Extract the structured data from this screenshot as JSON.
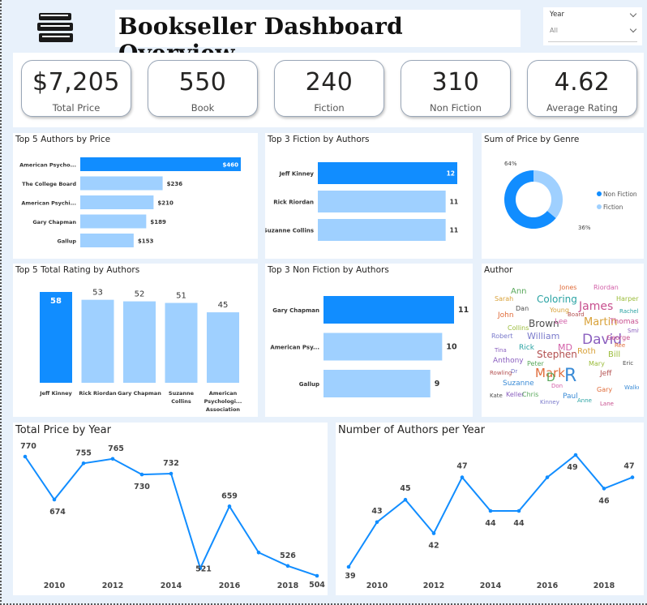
{
  "header": {
    "title": "Bookseller Dashboard Overview",
    "icon": "books-stack-icon",
    "slicer": {
      "label": "Year",
      "selected": "All"
    }
  },
  "kpis": [
    {
      "value": "$7,205",
      "label": "Total Price"
    },
    {
      "value": "550",
      "label": "Book"
    },
    {
      "value": "240",
      "label": "Fiction"
    },
    {
      "value": "310",
      "label": "Non Fiction"
    },
    {
      "value": "4.62",
      "label": "Average Rating"
    }
  ],
  "colors": {
    "accent": "#118dff",
    "light": "#9fd0ff",
    "line": "#118dff"
  },
  "chart_data": [
    {
      "id": "top5_price",
      "type": "bar",
      "orientation": "horizontal",
      "title": "Top 5 Authors by Price",
      "categories": [
        "American Psycho...",
        "The College Board",
        "American Psychi...",
        "Gary Chapman",
        "Gallup"
      ],
      "values": [
        460,
        236,
        210,
        189,
        153
      ],
      "labels": [
        "$460",
        "$236",
        "$210",
        "$189",
        "$153"
      ],
      "xlim": [
        0,
        460
      ]
    },
    {
      "id": "top3_fiction",
      "type": "bar",
      "orientation": "horizontal",
      "title": "Top 3 Fiction by Authors",
      "categories": [
        "Jeff Kinney",
        "Rick Riordan",
        "Suzanne Collins"
      ],
      "values": [
        12,
        11,
        11
      ],
      "labels": [
        "12",
        "11",
        "11"
      ],
      "xlim": [
        0,
        12
      ]
    },
    {
      "id": "price_by_genre",
      "type": "pie",
      "donut": true,
      "title": "Sum of Price by Genre",
      "categories": [
        "Non Fiction",
        "Fiction"
      ],
      "values": [
        64,
        36
      ],
      "labels": [
        "64%",
        "36%"
      ],
      "legend": "right"
    },
    {
      "id": "top5_rating",
      "type": "bar",
      "orientation": "vertical",
      "title": "Top 5 Total Rating by Authors",
      "categories": [
        "Jeff Kinney",
        "Rick Riordan",
        "Gary Chapman",
        "Suzanne Collins",
        "American Psychologi... Association"
      ],
      "values": [
        58,
        53,
        52,
        51,
        45
      ],
      "labels": [
        "58",
        "53",
        "52",
        "51",
        "45"
      ],
      "ylim": [
        0,
        58
      ]
    },
    {
      "id": "top3_nonfiction",
      "type": "bar",
      "orientation": "horizontal",
      "title": "Top 3 Non Fiction by Authors",
      "categories": [
        "Gary Chapman",
        "American Psy...",
        "Gallup"
      ],
      "values": [
        11,
        10,
        9
      ],
      "labels": [
        "11",
        "10",
        "9"
      ],
      "xlim": [
        0,
        11
      ]
    },
    {
      "id": "price_by_year",
      "type": "line",
      "title": "Total Price by Year",
      "x": [
        2009,
        2010,
        2011,
        2012,
        2013,
        2014,
        2015,
        2016,
        2017,
        2018,
        2019
      ],
      "values": [
        770,
        674,
        755,
        765,
        730,
        732,
        521,
        659,
        556,
        526,
        504
      ],
      "labels": [
        "770",
        "674",
        "755",
        "765",
        "730",
        "732",
        "521",
        "659",
        "",
        "526",
        "504"
      ],
      "xticks": [
        "2010",
        "2012",
        "2014",
        "2016",
        "2018"
      ]
    },
    {
      "id": "authors_per_year",
      "type": "line",
      "title": "Number of Authors per Year",
      "x": [
        2009,
        2010,
        2011,
        2012,
        2013,
        2014,
        2015,
        2016,
        2017,
        2018,
        2019
      ],
      "values": [
        39,
        43,
        45,
        42,
        47,
        44,
        44,
        47,
        49,
        46,
        47
      ],
      "labels": [
        "39",
        "43",
        "45",
        "42",
        "47",
        "44",
        "44",
        "",
        "49",
        "46",
        "47"
      ],
      "xticks": [
        "2010",
        "2012",
        "2014",
        "2016",
        "2018"
      ]
    }
  ],
  "author_cloud": {
    "title": "Author",
    "words": [
      "Mark",
      "David",
      "R",
      "D",
      "James",
      "Martin",
      "Brown",
      "Coloring",
      "Stephen",
      "William",
      "Bill",
      "MD",
      "John",
      "Anthony",
      "Suzanne",
      "Ann",
      "Thomas",
      "Roth",
      "Dan",
      "Rick",
      "Jeff",
      "Robert",
      "Harper",
      "Lee",
      "Gary",
      "Keller",
      "Paul",
      "Chris",
      "George",
      "Sarah",
      "Eric",
      "Anne",
      "Rowling",
      "Kinney",
      "Collins",
      "Riordan",
      "Jones",
      "Smith",
      "Walker",
      "Peter",
      "Lane",
      "Young",
      "Kate",
      "Rachel",
      "Board",
      "Dr",
      "Mary",
      "Don",
      "Ree",
      "Tina"
    ]
  }
}
